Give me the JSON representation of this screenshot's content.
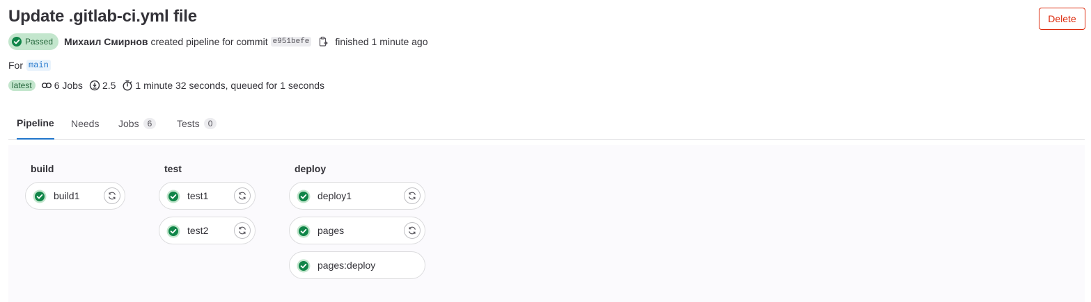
{
  "page": {
    "title": "Update .gitlab-ci.yml file",
    "delete_label": "Delete"
  },
  "summary": {
    "status": "Passed",
    "author": "Михаил Смирнов",
    "created_text": "created pipeline for commit",
    "commit_sha": "e951befe",
    "finished_text": "finished 1 minute ago",
    "for_label": "For",
    "branch": "main",
    "latest_badge": "latest",
    "jobs_text": "6 Jobs",
    "compute_text": "2.5",
    "duration_text": "1 minute 32 seconds, queued for 1 seconds"
  },
  "tabs": [
    {
      "label": "Pipeline",
      "count": null,
      "active": true
    },
    {
      "label": "Needs",
      "count": null,
      "active": false
    },
    {
      "label": "Jobs",
      "count": "6",
      "active": false
    },
    {
      "label": "Tests",
      "count": "0",
      "active": false
    }
  ],
  "stages": [
    {
      "name": "build",
      "jobs": [
        {
          "name": "build1",
          "status": "success",
          "retry": true
        }
      ]
    },
    {
      "name": "test",
      "jobs": [
        {
          "name": "test1",
          "status": "success",
          "retry": true
        },
        {
          "name": "test2",
          "status": "success",
          "retry": true
        }
      ]
    },
    {
      "name": "deploy",
      "jobs": [
        {
          "name": "deploy1",
          "status": "success",
          "retry": true
        },
        {
          "name": "pages",
          "status": "success",
          "retry": true
        },
        {
          "name": "pages:deploy",
          "status": "success",
          "retry": false
        }
      ]
    }
  ],
  "colors": {
    "success": "#108548",
    "success_bg": "#c3e6cd",
    "link": "#1f75cb",
    "danger": "#dd2b0e"
  },
  "icons": {
    "status": "status-success-icon",
    "copy": "copy-icon",
    "jobs": "pipeline-icon",
    "compute": "compute-icon",
    "duration": "timer-icon",
    "retry": "retry-icon"
  }
}
